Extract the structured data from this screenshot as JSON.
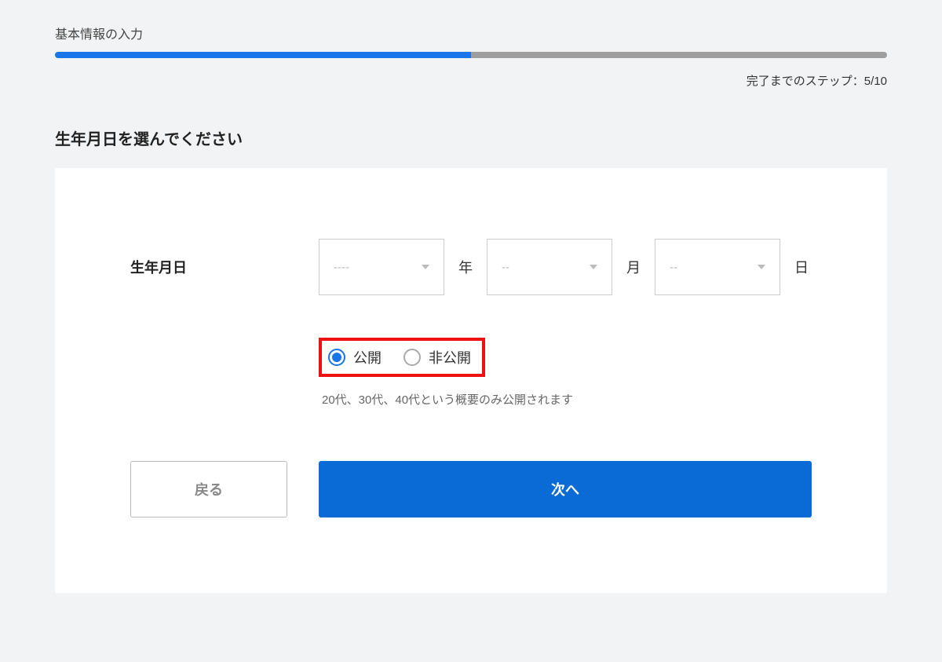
{
  "progress": {
    "label": "基本情報の入力",
    "percent": 50,
    "step_text": "完了までのステップ：5/10"
  },
  "heading": "生年月日を選んでください",
  "birthday": {
    "label": "生年月日",
    "year": {
      "placeholder": "----",
      "suffix": "年"
    },
    "month": {
      "placeholder": "--",
      "suffix": "月"
    },
    "day": {
      "placeholder": "--",
      "suffix": "日"
    }
  },
  "visibility": {
    "public_label": "公開",
    "private_label": "非公開",
    "help_text": "20代、30代、40代という概要のみ公開されます"
  },
  "buttons": {
    "back": "戻る",
    "next": "次へ"
  }
}
